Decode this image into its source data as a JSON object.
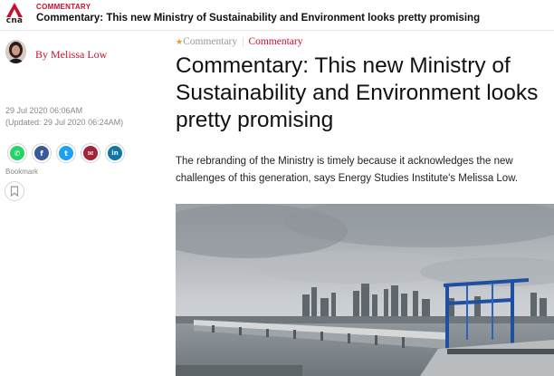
{
  "header": {
    "logo_text": "cna",
    "category": "COMMENTARY",
    "title": "Commentary: This new Ministry of Sustainability and Environment looks pretty promising"
  },
  "author": {
    "byline": "By Melissa Low"
  },
  "dates": {
    "published": "29 Jul 2020 06:06AM",
    "updated": "(Updated: 29 Jul 2020 06:24AM)"
  },
  "share": {
    "buttons": [
      {
        "icon": "whatsapp-icon",
        "glyph": "✆",
        "color": "#25d366"
      },
      {
        "icon": "facebook-icon",
        "glyph": "f",
        "color": "#3b5998"
      },
      {
        "icon": "twitter-icon",
        "glyph": "t",
        "color": "#1da1f2"
      },
      {
        "icon": "email-icon",
        "glyph": "✉",
        "color": "#a0243a"
      },
      {
        "icon": "linkedin-icon",
        "glyph": "in",
        "color": "#0e76a8"
      }
    ],
    "bookmark_label": "Bookmark"
  },
  "breadcrumb": {
    "section": "Commentary",
    "category": "Commentary"
  },
  "article": {
    "headline": "Commentary: This new Ministry of Sustainability and Environment looks pretty promising",
    "summary": "The rebranding of the Ministry is timely because it acknowledges the new challenges of this generation, says Energy Studies Institute's Melissa Low."
  },
  "colors": {
    "brand_red": "#c8102e",
    "star": "#e39a2d"
  }
}
